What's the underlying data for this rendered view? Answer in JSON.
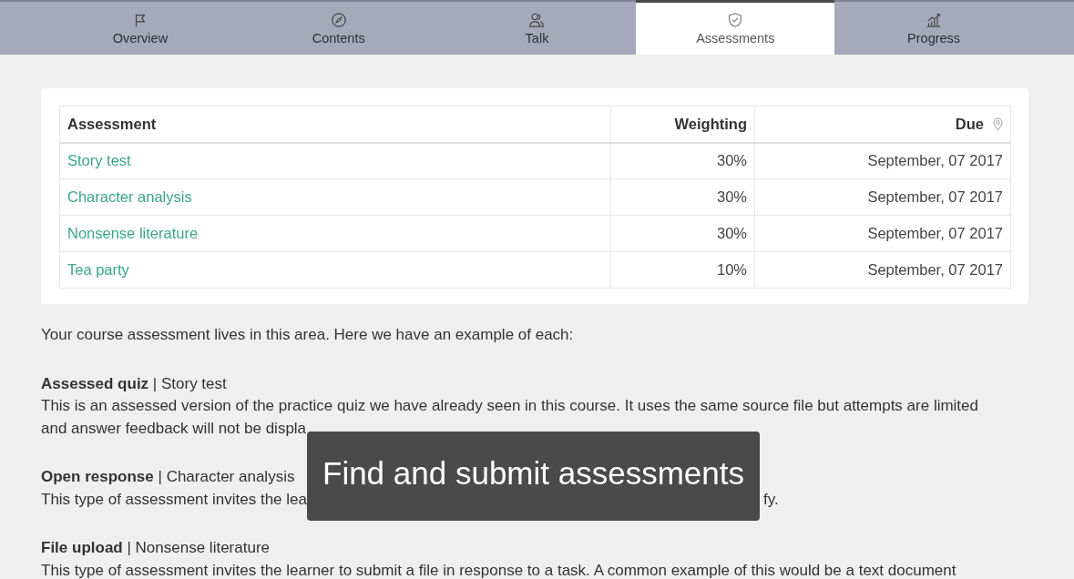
{
  "tabs": [
    {
      "label": "Overview",
      "selected": false
    },
    {
      "label": "Contents",
      "selected": false
    },
    {
      "label": "Talk",
      "selected": false
    },
    {
      "label": "Assessments",
      "selected": true
    },
    {
      "label": "Progress",
      "selected": false
    }
  ],
  "table": {
    "columns": [
      "Assessment",
      "Weighting",
      "Due"
    ],
    "rows": [
      {
        "assessment": "Story test",
        "weighting": "30%",
        "due": "September, 07 2017"
      },
      {
        "assessment": "Character analysis",
        "weighting": "30%",
        "due": "September, 07 2017"
      },
      {
        "assessment": "Nonsense literature",
        "weighting": "30%",
        "due": "September, 07 2017"
      },
      {
        "assessment": "Tea party",
        "weighting": "10%",
        "due": "September, 07 2017"
      }
    ]
  },
  "intro": "Your course assessment lives in this area. Here we have an example of each:",
  "sections": [
    {
      "title": "**Assessed quiz** | Story test",
      "description_parts": [
        "This is an assessed version of the practice quiz we have already seen in this course. It uses the same source file but attempts are limited and answer feedback will not be displa"
      ]
    },
    {
      "title": "**Open response** | Character analysis",
      "description_parts": [
        "This type of assessment invites the lea",
        "fy."
      ]
    },
    {
      "title": "**File upload** | Nonsense literature",
      "description_parts": [
        "This type of assessment invites the learner to submit a file in response to a task. A common example of this would be a text document"
      ]
    }
  ],
  "caption": "Find and submit assessments"
}
